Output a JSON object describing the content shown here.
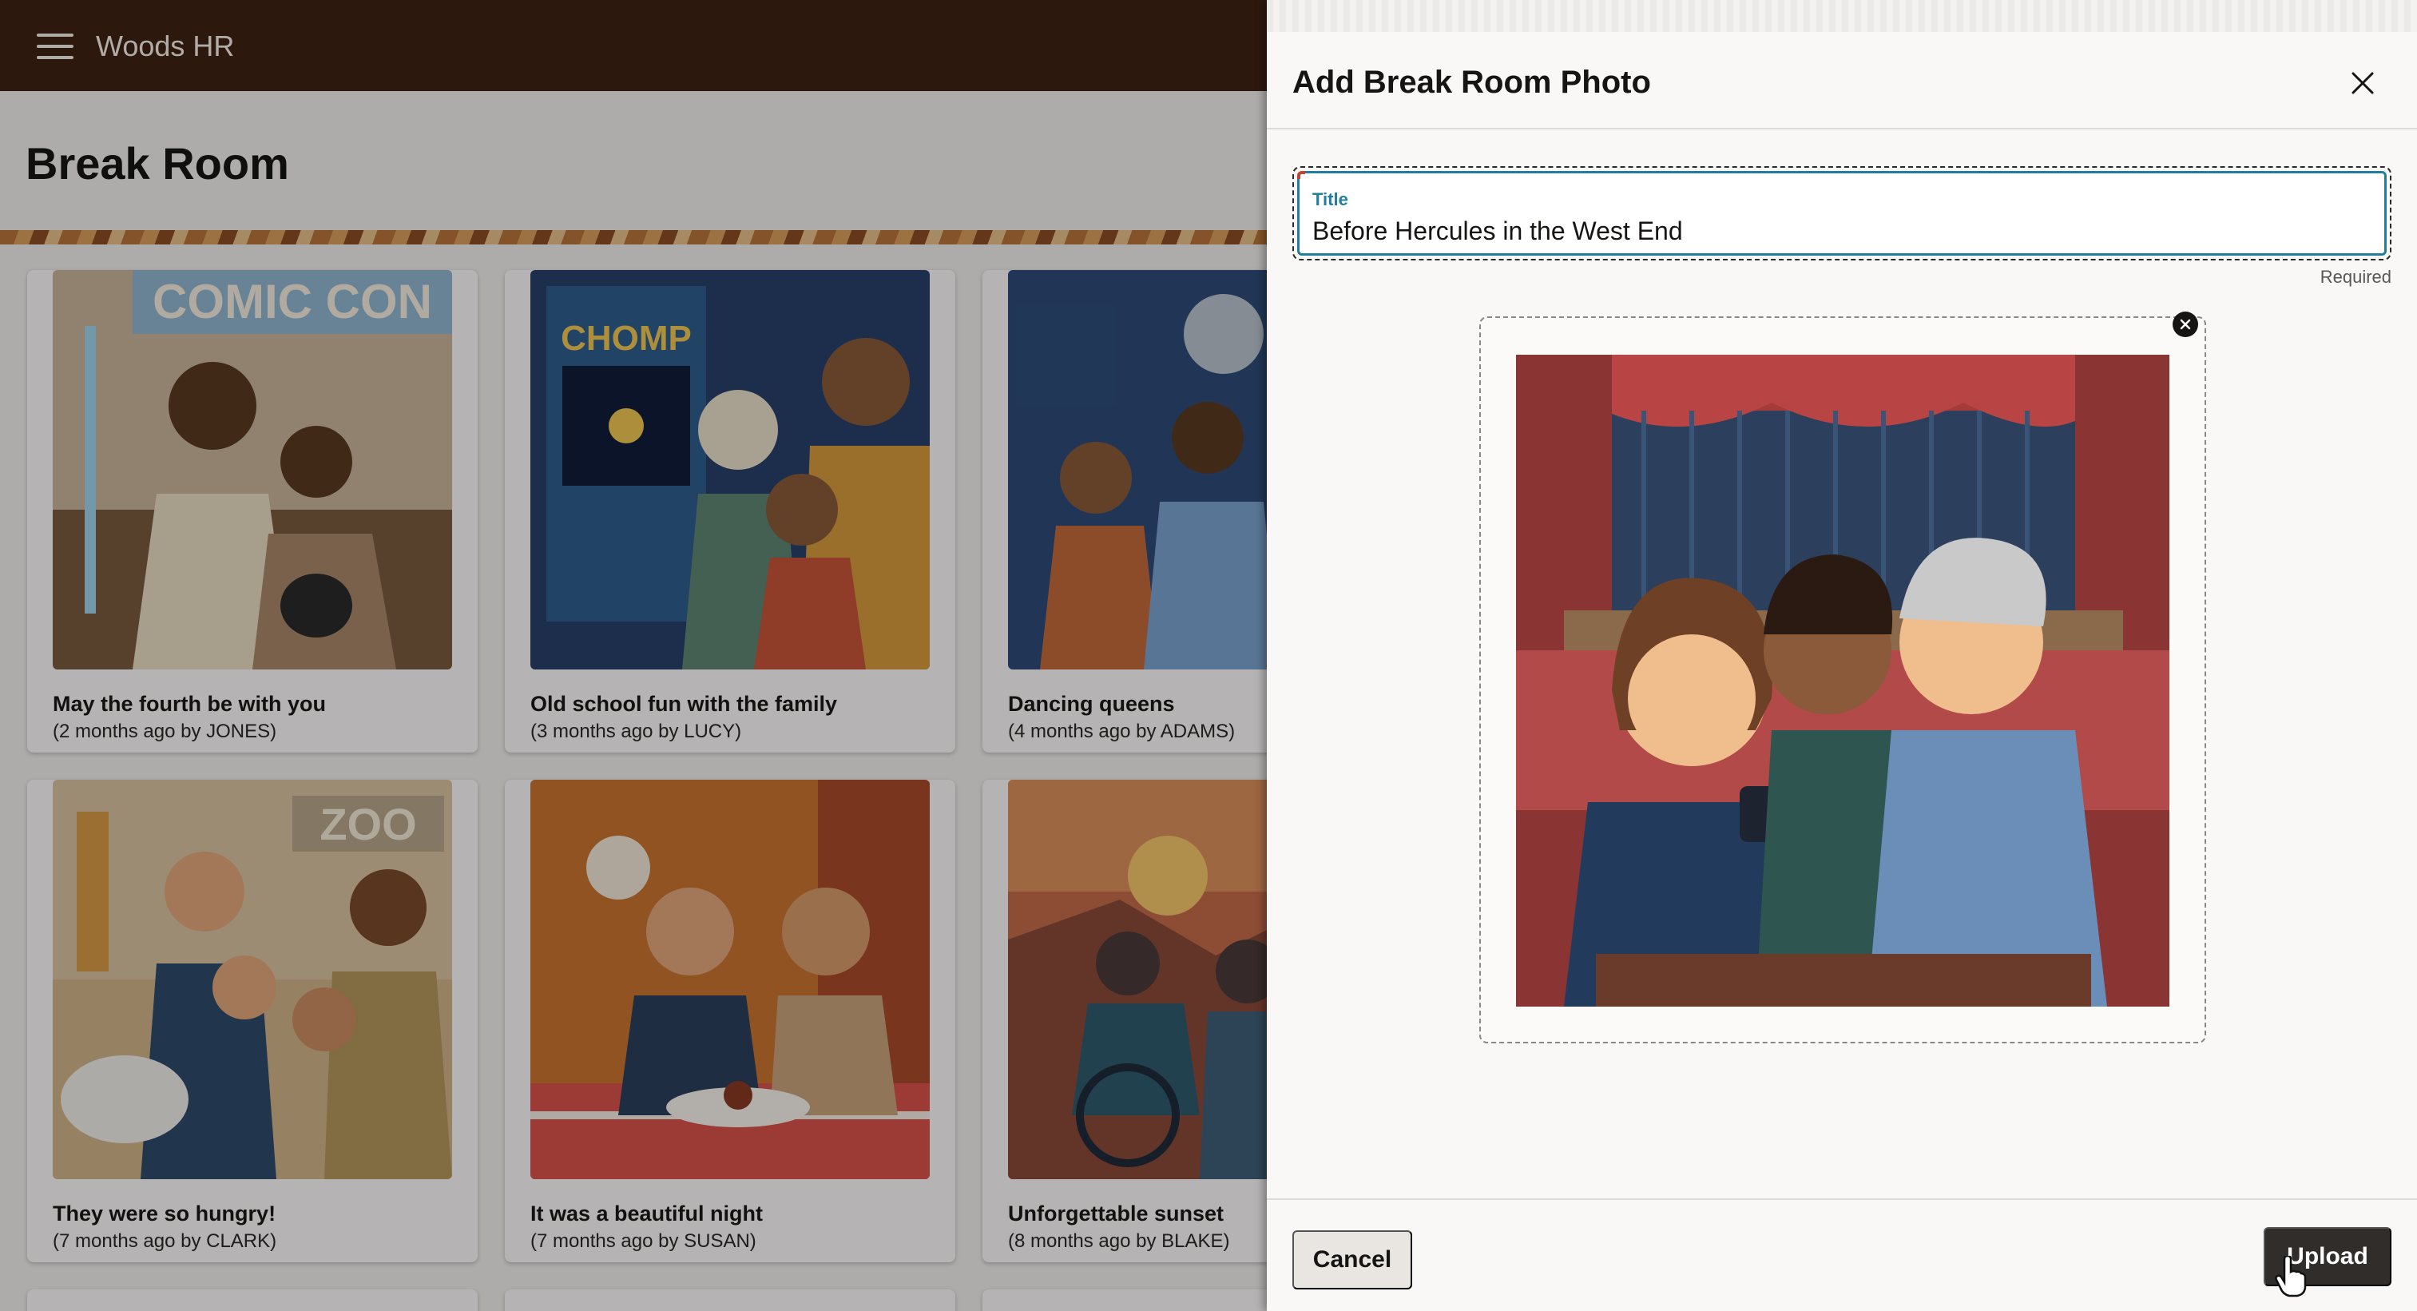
{
  "app": {
    "title": "Woods HR",
    "menu_icon": "hamburger-icon"
  },
  "page": {
    "title": "Break Room"
  },
  "cards": [
    {
      "title": "May the fourth be with you",
      "meta": "(2 months ago by JONES)",
      "image_text": "COMIC CON"
    },
    {
      "title": "Old school fun with the family",
      "meta": "(3 months ago by LUCY)",
      "image_text": "CHOMP"
    },
    {
      "title": "Dancing queens",
      "meta": "(4 months ago by ADAMS)"
    },
    {
      "title": "They were so hungry!",
      "meta": "(7 months ago by CLARK)",
      "image_text": "ZOO"
    },
    {
      "title": "It was a beautiful night",
      "meta": "(7 months ago by SUSAN)"
    },
    {
      "title": "Unforgettable sunset",
      "meta": "(8 months ago by BLAKE)"
    }
  ],
  "drawer": {
    "title": "Add Break Room Photo",
    "close_icon": "close-icon",
    "field": {
      "label": "Title",
      "value": "Before Hercules in the West End",
      "hint": "Required"
    },
    "remove_icon": "remove-icon",
    "cancel_label": "Cancel",
    "upload_label": "Upload"
  },
  "colors": {
    "header": "#3f2213",
    "accent": "#227e9e",
    "primary_button": "#312d2a",
    "required_marker": "#c7432f"
  }
}
